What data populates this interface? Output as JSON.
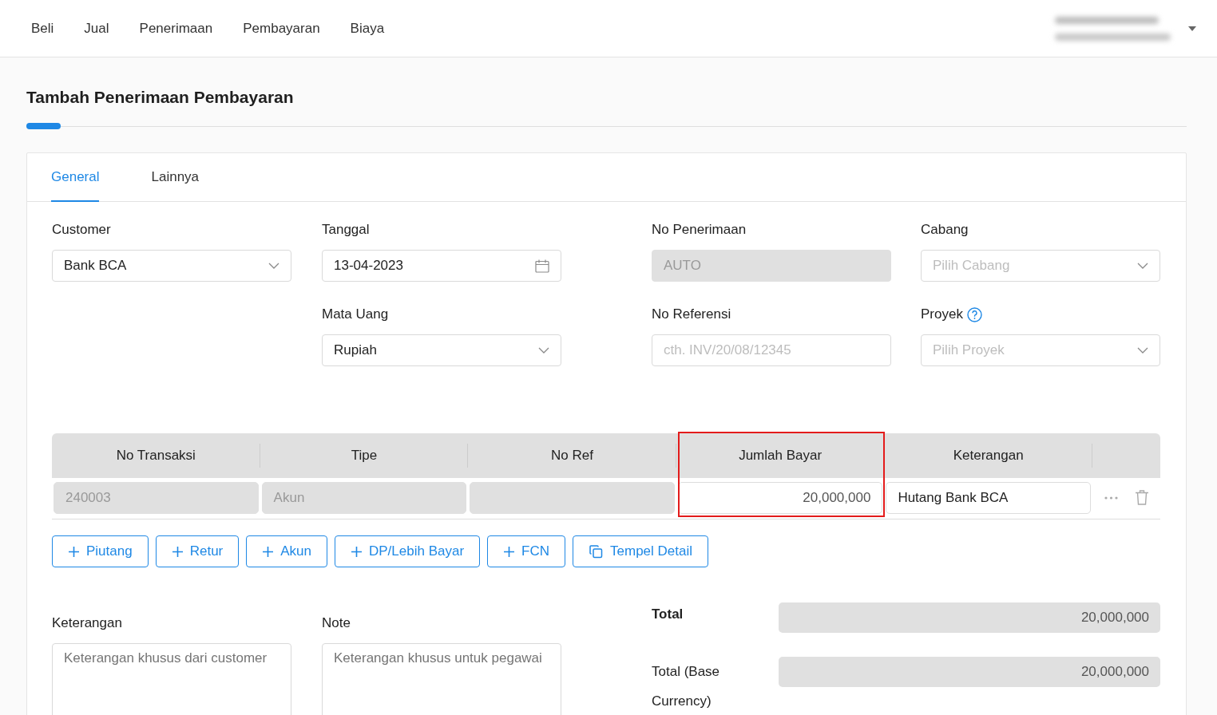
{
  "nav": {
    "items": [
      {
        "label": "Beli"
      },
      {
        "label": "Jual"
      },
      {
        "label": "Penerimaan"
      },
      {
        "label": "Pembayaran"
      },
      {
        "label": "Biaya"
      }
    ]
  },
  "page": {
    "title": "Tambah Penerimaan Pembayaran"
  },
  "tabs": [
    {
      "label": "General",
      "selected": true
    },
    {
      "label": "Lainnya",
      "selected": false
    }
  ],
  "form": {
    "rows": [
      [
        {
          "label": "Customer",
          "kind": "select",
          "value": "Bank BCA"
        },
        {
          "label": "Tanggal",
          "kind": "date",
          "value": "13-04-2023"
        },
        {
          "label": "No Penerimaan",
          "kind": "readonly",
          "value": "AUTO"
        },
        {
          "label": "Cabang",
          "kind": "select",
          "placeholder": "Pilih Cabang"
        }
      ],
      [
        "",
        {
          "label": "Mata Uang",
          "kind": "select",
          "value": "Rupiah"
        },
        {
          "label": "No Referensi",
          "kind": "text",
          "placeholder": "cth. INV/20/08/12345"
        },
        {
          "label": "Proyek",
          "kind": "select",
          "placeholder": "Pilih Proyek",
          "help": true
        }
      ]
    ]
  },
  "table": {
    "columns": [
      {
        "label": "No Transaksi",
        "highlighted": false
      },
      {
        "label": "Tipe",
        "highlighted": false
      },
      {
        "label": "No Ref",
        "highlighted": false
      },
      {
        "label": "Jumlah Bayar",
        "highlighted": true
      },
      {
        "label": "Keterangan",
        "highlighted": false
      }
    ],
    "rows": [
      {
        "cells": [
          {
            "kind": "readonly",
            "value": "240003"
          },
          {
            "kind": "readonly",
            "value": "Akun"
          },
          {
            "kind": "readonly"
          },
          {
            "kind": "number",
            "value": "20,000,000"
          },
          {
            "kind": "text",
            "value": "Hutang Bank BCA"
          }
        ]
      }
    ]
  },
  "add_buttons": [
    {
      "label": "Piutang",
      "kind": "add"
    },
    {
      "label": "Retur",
      "kind": "add"
    },
    {
      "label": "Akun",
      "kind": "add"
    },
    {
      "label": "DP/Lebih Bayar",
      "kind": "add"
    },
    {
      "label": "FCN",
      "kind": "add"
    },
    {
      "label": "Tempel Detail",
      "kind": "paste"
    }
  ],
  "notes": [
    {
      "label": "Keterangan",
      "placeholder": "Keterangan khusus dari customer"
    },
    {
      "label": "Note",
      "placeholder": "Keterangan khusus untuk pegawai"
    }
  ],
  "totals": [
    {
      "label": "Total",
      "bold": true,
      "value": "20,000,000"
    },
    {
      "label": "Total (Base Currency)",
      "bold": false,
      "value": "20,000,000"
    }
  ]
}
